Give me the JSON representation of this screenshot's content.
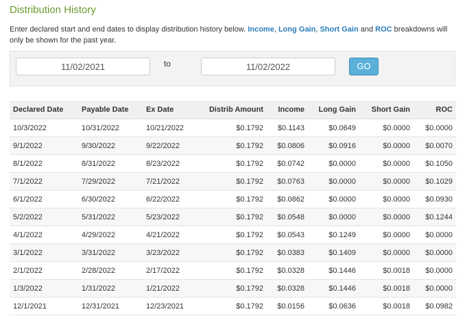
{
  "page": {
    "title": "Distribution History",
    "intro": {
      "before": "Enter declared start and end dates to display distribution history below. ",
      "income": "Income",
      "comma1": ", ",
      "long_gain": "Long Gain",
      "comma2": ", ",
      "short_gain": "Short Gain",
      "and": " and ",
      "roc": "ROC",
      "after": " breakdowns will only be shown for the past year."
    }
  },
  "filter": {
    "start_date": "11/02/2021",
    "to_label": "to",
    "end_date": "11/02/2022",
    "go_label": "GO"
  },
  "table": {
    "columns": [
      "Declared Date",
      "Payable Date",
      "Ex Date",
      "Distrib Amount",
      "Income",
      "Long Gain",
      "Short Gain",
      "ROC"
    ],
    "rows": [
      [
        "10/3/2022",
        "10/31/2022",
        "10/21/2022",
        "$0.1792",
        "$0.1143",
        "$0.0649",
        "$0.0000",
        "$0.0000"
      ],
      [
        "9/1/2022",
        "9/30/2022",
        "9/22/2022",
        "$0.1792",
        "$0.0806",
        "$0.0916",
        "$0.0000",
        "$0.0070"
      ],
      [
        "8/1/2022",
        "8/31/2022",
        "8/23/2022",
        "$0.1792",
        "$0.0742",
        "$0.0000",
        "$0.0000",
        "$0.1050"
      ],
      [
        "7/1/2022",
        "7/29/2022",
        "7/21/2022",
        "$0.1792",
        "$0.0763",
        "$0.0000",
        "$0.0000",
        "$0.1029"
      ],
      [
        "6/1/2022",
        "6/30/2022",
        "6/22/2022",
        "$0.1792",
        "$0.0862",
        "$0.0000",
        "$0.0000",
        "$0.0930"
      ],
      [
        "5/2/2022",
        "5/31/2022",
        "5/23/2022",
        "$0.1792",
        "$0.0548",
        "$0.0000",
        "$0.0000",
        "$0.1244"
      ],
      [
        "4/1/2022",
        "4/29/2022",
        "4/21/2022",
        "$0.1792",
        "$0.0543",
        "$0.1249",
        "$0.0000",
        "$0.0000"
      ],
      [
        "3/1/2022",
        "3/31/2022",
        "3/23/2022",
        "$0.1792",
        "$0.0383",
        "$0.1409",
        "$0.0000",
        "$0.0000"
      ],
      [
        "2/1/2022",
        "2/28/2022",
        "2/17/2022",
        "$0.1792",
        "$0.0328",
        "$0.1446",
        "$0.0018",
        "$0.0000"
      ],
      [
        "1/3/2022",
        "1/31/2022",
        "1/21/2022",
        "$0.1792",
        "$0.0328",
        "$0.1446",
        "$0.0018",
        "$0.0000"
      ],
      [
        "12/1/2021",
        "12/31/2021",
        "12/23/2021",
        "$0.1792",
        "$0.0156",
        "$0.0636",
        "$0.0018",
        "$0.0982"
      ]
    ]
  },
  "colors": {
    "title": "#6b9a2e",
    "highlight": "#2a7cb8",
    "go_button": "#5ab0d8"
  }
}
